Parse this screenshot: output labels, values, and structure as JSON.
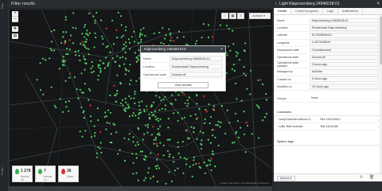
{
  "rail": {
    "top_text": "Map",
    "bottom_text": "Profile"
  },
  "map": {
    "title": "Filter results",
    "zoom_in": "+",
    "zoom_out": "−",
    "toolbar_actions": "Actions",
    "attribution": "Leaflet | Map data © OpenStreetMap contributors"
  },
  "popup": {
    "title": "Klaprozenberg 24846018-01",
    "rows": [
      {
        "label": "Name",
        "value": "Klaprozenberg 24846018-01"
      },
      {
        "label": "Location",
        "value": "Roosendaal Klaprozenberg"
      },
      {
        "label": "Operational state",
        "value": "Normal off"
      }
    ],
    "button": "View details"
  },
  "legend": [
    {
      "count": "1 279",
      "label": "Normal off",
      "color": "#37b24d"
    },
    {
      "count": "7",
      "label": "Normal on",
      "color": "#37b24d"
    },
    {
      "count": "36",
      "label": "Alarm",
      "color": "#e03131"
    }
  ],
  "panel": {
    "title": "Light Klaprozenberg 24846018-01",
    "tabs": [
      "Details",
      "Control programs",
      "Logs",
      "Notifications"
    ],
    "active_tab": "Details",
    "fields": [
      {
        "label": "Name",
        "value": "Klaprozenberg 24846018-01"
      },
      {
        "label": "Location",
        "value": "Roosendaal Klaprozenberg"
      },
      {
        "label": "Latitude",
        "value": "51.5328846441"
      },
      {
        "label": "Longitude",
        "value": "4.4573448519"
      },
      {
        "label": "Deployment state",
        "value": "Commissioned"
      },
      {
        "label": "Operational state",
        "value": "Normal off"
      },
      {
        "label": "Operational state updated",
        "value": "3 hours ago"
      },
      {
        "label": "Managed by",
        "value": "ksGlobe"
      },
      {
        "label": "Created on",
        "value": "5 hours ago"
      },
      {
        "label": "Modified on",
        "value": "10 hours ago"
      }
    ],
    "groups_label": "Groups",
    "groups_value": "None",
    "controllers_title": "Controllers",
    "controllers": [
      {
        "name": "LampController without G...",
        "type": "Flex 14411008-1"
      },
      {
        "name": "LuBa TeleController",
        "type": "Tele 14411008"
      }
    ],
    "system_title": "System tags",
    "footer_actions": "Actions"
  }
}
